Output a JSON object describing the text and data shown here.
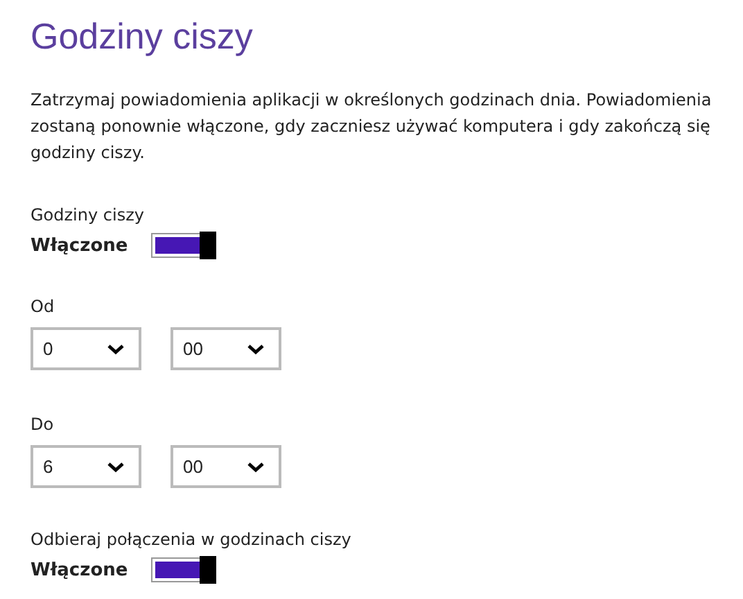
{
  "title": "Godziny ciszy",
  "description": "Zatrzymaj powiadomienia aplikacji w określonych godzinach dnia. Powiadomienia zostaną ponownie włączone, gdy zaczniesz używać komputera i gdy zakończą się godziny ciszy.",
  "settings": [
    {
      "kind": "toggle",
      "label": "Godziny ciszy",
      "state_text": "Włączone",
      "on": true
    },
    {
      "kind": "time",
      "label": "Od",
      "hour": "0",
      "minute": "00"
    },
    {
      "kind": "time",
      "label": "Do",
      "hour": "6",
      "minute": "00"
    },
    {
      "kind": "toggle",
      "label": "Odbieraj połączenia w godzinach ciszy",
      "state_text": "Włączone",
      "on": true
    }
  ]
}
